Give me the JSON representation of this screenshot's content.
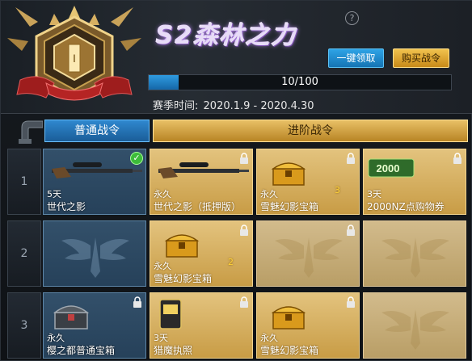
{
  "header": {
    "season_title": "S2森林之力",
    "claim_button": "一键领取",
    "buy_button": "购买战令",
    "progress": {
      "current": 10,
      "max": 100,
      "text": "10/100"
    },
    "season_time_label": "赛季时间:",
    "season_time_value": "2020.1.9 - 2020.4.30",
    "badge_level": "I"
  },
  "tabs": {
    "normal": "普通战令",
    "advanced": "进阶战令"
  },
  "rows": [
    {
      "num": "1"
    },
    {
      "num": "2"
    },
    {
      "num": "3"
    }
  ],
  "rewards": {
    "r1": {
      "normal": {
        "duration": "5天",
        "name": "世代之影",
        "claimed": true,
        "icon": "sniper-rifle-icon"
      },
      "adv1": {
        "duration": "永久",
        "name": "世代之影（抵押版）",
        "locked": true,
        "icon": "sniper-rifle-icon"
      },
      "adv2": {
        "duration": "永久",
        "name": "雪魅幻影宝箱",
        "qty": "3",
        "locked": true,
        "icon": "gold-chest-icon"
      },
      "adv3": {
        "duration": "3天",
        "name": "2000NZ点购物券",
        "locked": true,
        "icon": "voucher-icon",
        "icon_text": "2000"
      }
    },
    "r2": {
      "normal": {
        "empty": true
      },
      "adv1": {
        "duration": "永久",
        "name": "雪魅幻影宝箱",
        "qty": "2",
        "locked": true,
        "icon": "gold-chest-icon"
      },
      "adv2": {
        "empty": true,
        "locked": true
      },
      "adv3": {
        "empty": true
      }
    },
    "r3": {
      "normal": {
        "duration": "永久",
        "name": "樱之都普通宝箱",
        "locked": true,
        "icon": "dark-chest-icon"
      },
      "adv1": {
        "duration": "3天",
        "name": "猎魔执照",
        "locked": true,
        "icon": "license-icon",
        "icon_text": "猎魔执照"
      },
      "adv2": {
        "duration": "永久",
        "name": "雪魅幻影宝箱",
        "locked": true,
        "icon": "gold-chest-icon"
      },
      "adv3": {
        "empty": true
      }
    }
  },
  "colors": {
    "normal_tab": "#2f88cf",
    "advanced_tab": "#e8c066",
    "progress_fill": "#2f9be0",
    "claimed_check": "#3dbb3a"
  }
}
